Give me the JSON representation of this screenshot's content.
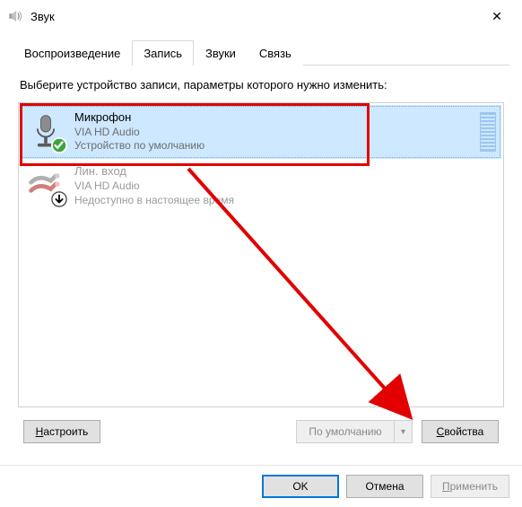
{
  "window": {
    "title": "Звук",
    "close_glyph": "✕"
  },
  "tabs": {
    "playback": "Воспроизведение",
    "recording": "Запись",
    "sounds": "Звуки",
    "communications": "Связь"
  },
  "instruction": "Выберите устройство записи, параметры которого нужно изменить:",
  "devices": [
    {
      "name": "Микрофон",
      "sub": "VIA HD Audio",
      "status": "Устройство по умолчанию"
    },
    {
      "name": "Лин. вход",
      "sub": "VIA HD Audio",
      "status": "Недоступно в настоящее время"
    }
  ],
  "buttons": {
    "configure": "Настроить",
    "configure_u": "Н",
    "set_default": "По умолчанию",
    "properties": "Свойства",
    "properties_u": "С",
    "ok": "OK",
    "cancel": "Отмена",
    "apply": "Применить",
    "apply_u": "П",
    "dropdown_glyph": "▾"
  }
}
